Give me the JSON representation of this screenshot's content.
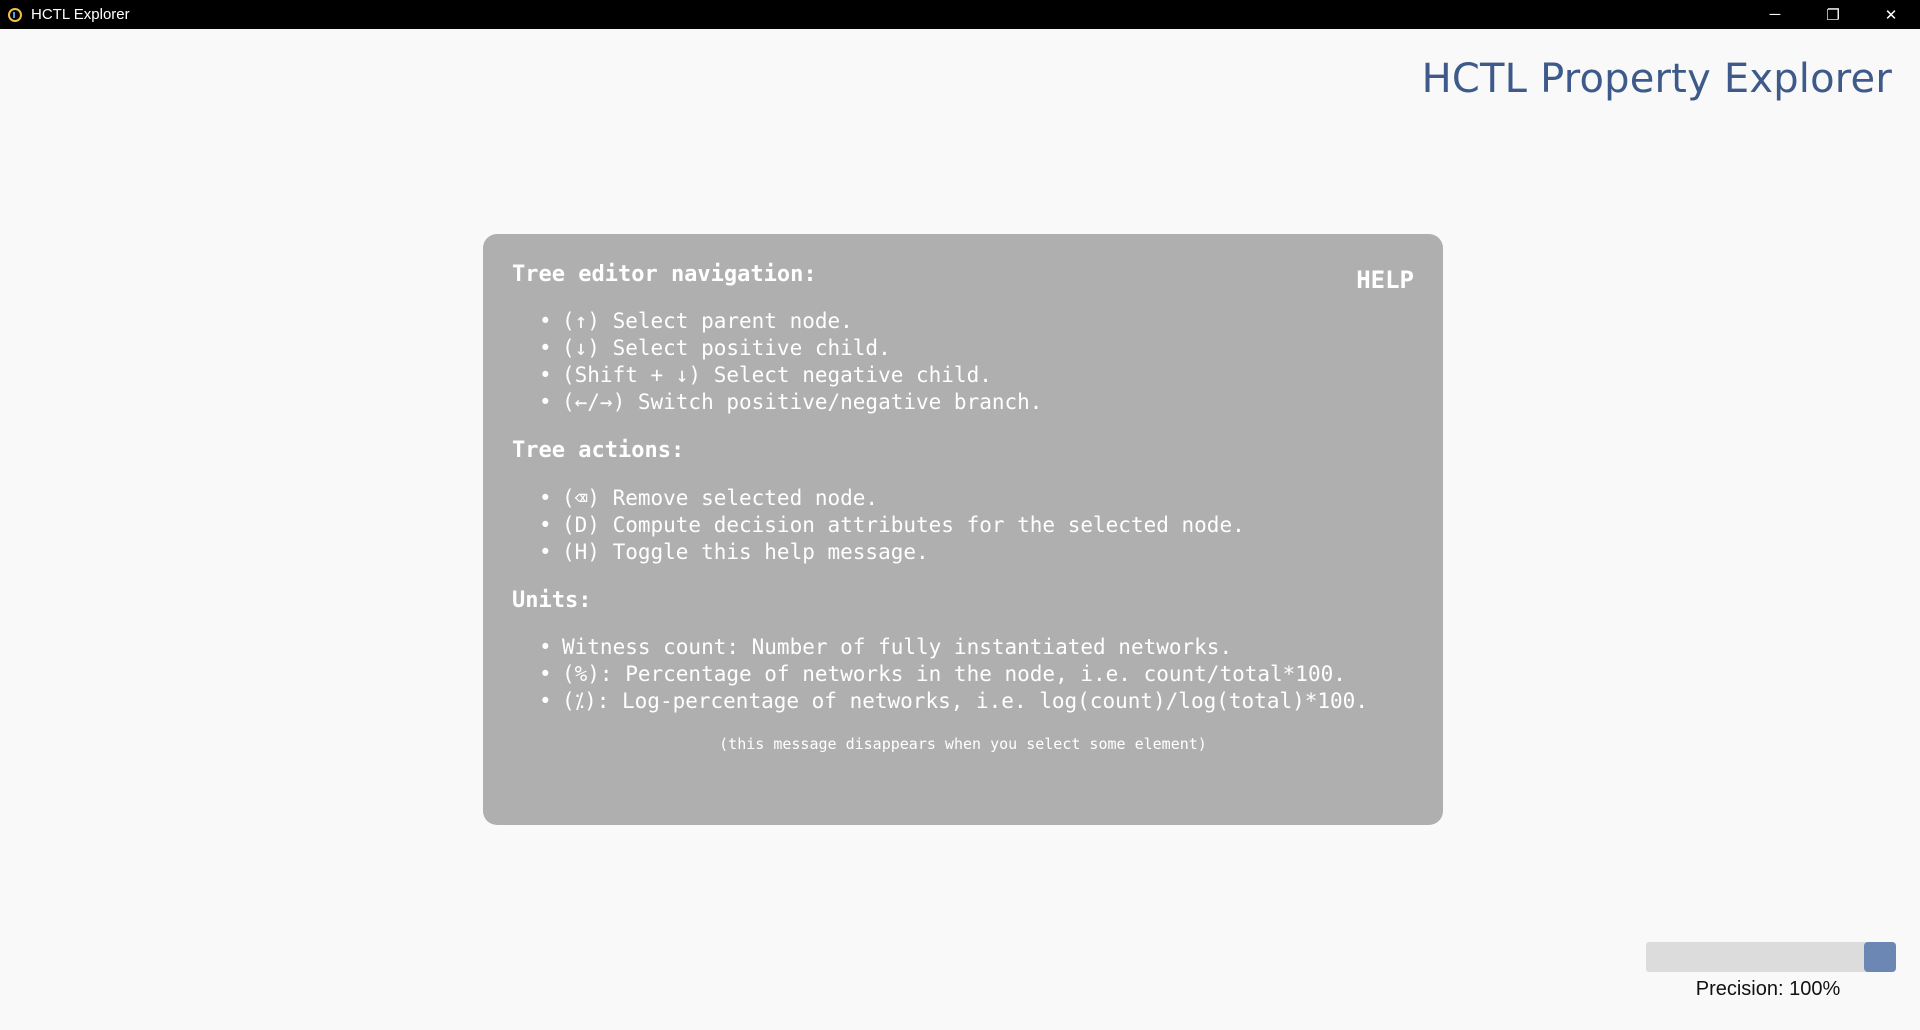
{
  "window": {
    "title": "HCTL Explorer",
    "controls": {
      "minimize_icon": "─",
      "restore_icon": "❐",
      "close_icon": "✕"
    }
  },
  "app": {
    "heading": "HCTL Property Explorer"
  },
  "help": {
    "badge": "HELP",
    "sections": [
      {
        "heading": "Tree editor navigation:",
        "items": [
          "(↑) Select parent node.",
          "(↓) Select positive child.",
          "(Shift + ↓) Select negative child.",
          "(←/→) Switch positive/negative branch."
        ]
      },
      {
        "heading": "Tree actions:",
        "items": [
          "(⌫) Remove selected node.",
          "(D) Compute decision attributes for the selected node.",
          "(H) Toggle this help message."
        ]
      },
      {
        "heading": "Units:",
        "items": [
          "Witness count: Number of fully instantiated networks.",
          "(%): Percentage of networks in the node, i.e. count/total*100.",
          "(⁒): Log-percentage of networks, i.e. log(count)/log(total)*100."
        ]
      }
    ],
    "footer": "(this message disappears when you select some element)"
  },
  "precision": {
    "label": "Precision: 100%",
    "value": 1.0
  },
  "colors": {
    "heading": "#3d5a8a",
    "panel_bg": "#afafaf",
    "slider_handle": "#6d87b5"
  }
}
